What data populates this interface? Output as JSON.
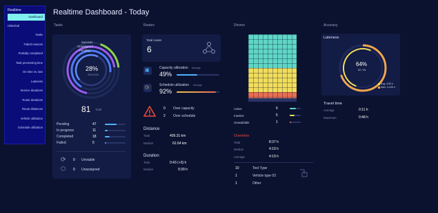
{
  "sidebar": {
    "header": "Realtime",
    "active": "Dashboard",
    "historical": "Historical",
    "items": [
      "Tasks",
      "Failed reasons",
      "Partially completed",
      "Task processing time",
      "On time vs. late",
      "Lateness",
      "Service durations",
      "Route durations",
      "Route distances",
      "Vehicle utilization",
      "Schedule utilization"
    ]
  },
  "page_title": "Realtime Dashboard - Today",
  "tasks": {
    "label": "Tasks",
    "ring_labels": [
      "Success",
      "Unassigned",
      "Pending"
    ],
    "percent": "28%",
    "percent_sub": "Success",
    "total": "81",
    "total_label": "Total",
    "rows": [
      {
        "label": "Pending",
        "value": "47",
        "fill": 0.58,
        "color": "#4fb3ff"
      },
      {
        "label": "In progress",
        "value": "11",
        "fill": 0.14,
        "color": "#4fb3ff"
      },
      {
        "label": "Completed",
        "value": "18",
        "fill": 0.22,
        "color": "#4fb3ff"
      },
      {
        "label": "Failed",
        "value": "5",
        "fill": 0.06,
        "color": "#4fb3ff"
      }
    ],
    "bottom": [
      {
        "icon": "sync-icon",
        "value": "0",
        "label": "Unviable"
      },
      {
        "icon": "box-icon",
        "value": "0",
        "label": "Unassigned"
      }
    ]
  },
  "routes": {
    "label": "Routes",
    "total_label": "Total routes",
    "total": "6",
    "capacity_label": "Capacity utilization",
    "capacity_tag": "Average",
    "capacity_value": "49%",
    "capacity_fill": 0.49,
    "schedule_label": "Schedule utilization",
    "schedule_tag": "Average",
    "schedule_value": "92%",
    "schedule_fill": 0.92,
    "alerts": [
      {
        "value": "0",
        "label": "Over capacity"
      },
      {
        "value": "2",
        "label": "Over schedule"
      }
    ],
    "distance_title": "Distance",
    "distance": [
      {
        "label": "Total",
        "value": "409.31 km"
      },
      {
        "label": "Median",
        "value": "62.64 km"
      }
    ],
    "duration_title": "Duration",
    "duration": [
      {
        "label": "Total",
        "value": "0:43 (+3) h"
      },
      {
        "label": "Median",
        "value": "9:39 h"
      }
    ]
  },
  "drivers": {
    "label": "Drivers",
    "grid_share": {
      "active": 0.5,
      "inactive": 0.36,
      "unavailable": 0.09
    },
    "colors": {
      "active": "#5fd6c6",
      "inactive": "#f1dd5a",
      "unavailable": "#e86e52",
      "track": "#2a3566"
    },
    "rows": [
      {
        "label": "Active",
        "value": "6",
        "fill": 0.55,
        "color": "#5fd6c6"
      },
      {
        "label": "Inactive",
        "value": "5",
        "fill": 0.45,
        "color": "#f1dd5a"
      },
      {
        "label": "Unavailable",
        "value": "1",
        "fill": 0.1,
        "color": "#e86e52"
      }
    ],
    "overtime_title": "Overtime",
    "overtime": [
      {
        "label": "Total",
        "value": "8:37 h"
      },
      {
        "label": "Median",
        "value": "4:19 h"
      },
      {
        "label": "Average",
        "value": "4:19 h"
      }
    ],
    "types": [
      {
        "value": "10",
        "label": "Test Type"
      },
      {
        "value": "1",
        "label": "Vehicle type 03"
      },
      {
        "value": "1",
        "label": "Other"
      }
    ]
  },
  "accuracy": {
    "label": "Accuracy",
    "lateness_title": "Lateness",
    "percent": "64%",
    "fraction": "52 / 81",
    "legend": [
      "Avg: 4:50 h",
      "Max: 14:08 h"
    ],
    "travel_title": "Travel time",
    "travel": [
      {
        "label": "Average",
        "value": "0:11 h"
      },
      {
        "label": "Maximum",
        "value": "0:48 h"
      }
    ]
  }
}
